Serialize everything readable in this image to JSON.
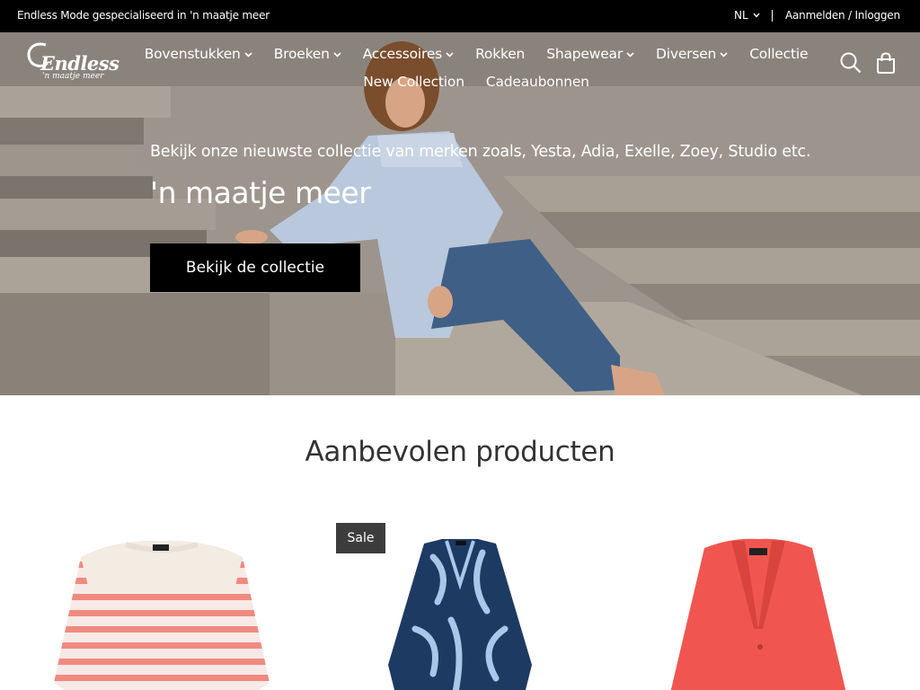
{
  "topbar": {
    "tagline": "Endless Mode gespecialiseerd in 'n maatje meer",
    "language": "NL",
    "account": "Aanmelden / Inloggen"
  },
  "logo": {
    "brand": "Endless",
    "subline": "'n maatje meer"
  },
  "nav": {
    "row1": [
      {
        "label": "Bovenstukken",
        "dropdown": true
      },
      {
        "label": "Broeken",
        "dropdown": true
      },
      {
        "label": "Accessoires",
        "dropdown": true
      },
      {
        "label": "Rokken",
        "dropdown": false
      },
      {
        "label": "Shapewear",
        "dropdown": true
      },
      {
        "label": "Diversen",
        "dropdown": true
      },
      {
        "label": "Collectie",
        "dropdown": false
      }
    ],
    "row2": [
      {
        "label": "New Collection",
        "dropdown": false
      },
      {
        "label": "Cadeaubonnen",
        "dropdown": false
      }
    ]
  },
  "header_icons": [
    "search-icon",
    "shopping-bag-icon"
  ],
  "hero": {
    "subtitle": "Bekijk onze nieuwste collectie van merken zoals, Yesta, Adia, Exelle, Zoey, Studio etc.",
    "title": "'n maatje meer",
    "cta": "Bekijk de collectie"
  },
  "recommended": {
    "title": "Aanbevolen producten",
    "products": [
      {
        "badge": null
      },
      {
        "badge": "Sale"
      },
      {
        "badge": null
      }
    ]
  },
  "colors": {
    "topbar": "#000000",
    "cta": "#000000",
    "sale_badge": "#3d3d3d",
    "coral": "#f0564f",
    "navy": "#1d3a63"
  }
}
